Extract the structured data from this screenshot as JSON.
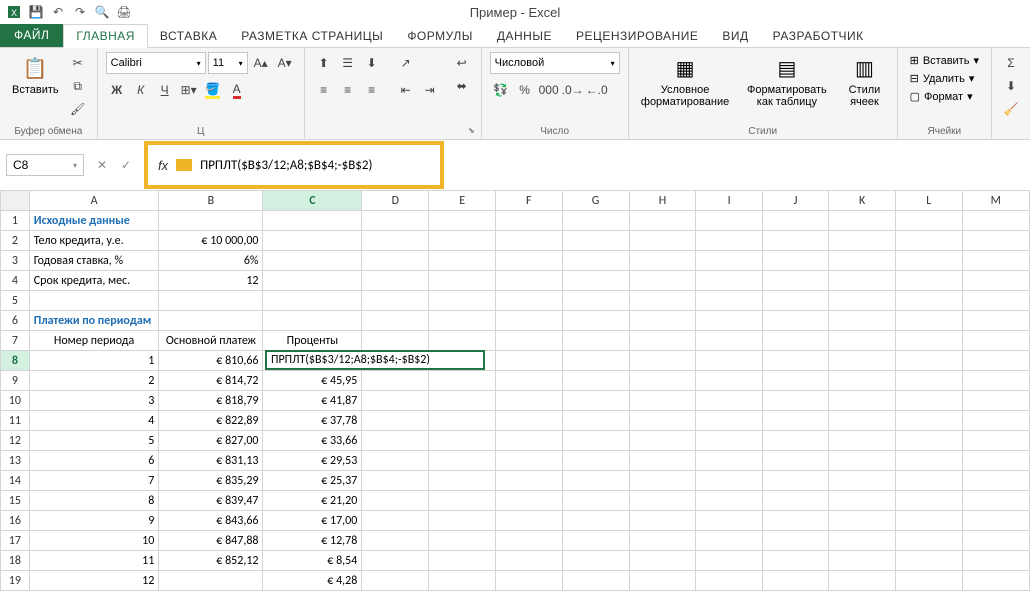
{
  "app": {
    "title": "Пример - Excel"
  },
  "qat": {
    "save": "💾",
    "undo": "↶",
    "redo": "↷",
    "preview": "🔍",
    "print": "🖨"
  },
  "tabs": {
    "file": "ФАЙЛ",
    "items": [
      "ГЛАВНАЯ",
      "ВСТАВКА",
      "РАЗМЕТКА СТРАНИЦЫ",
      "ФОРМУЛЫ",
      "ДАННЫЕ",
      "РЕЦЕНЗИРОВАНИЕ",
      "ВИД",
      "РАЗРАБОТЧИК"
    ],
    "active": 0
  },
  "ribbon": {
    "clipboard": {
      "label": "Буфер обмена",
      "paste": "Вставить"
    },
    "font": {
      "label": "Ц",
      "name": "Calibri",
      "size": "11",
      "bold": "Ж",
      "italic": "К",
      "underline": "Ч"
    },
    "number": {
      "label": "Число",
      "format": "Числовой"
    },
    "styles": {
      "label": "Стили",
      "cond": "Условное форматирование",
      "table": "Форматировать как таблицу",
      "cell": "Стили ячеек"
    },
    "cells": {
      "label": "Ячейки",
      "insert": "Вставить",
      "delete": "Удалить",
      "format": "Формат"
    }
  },
  "namebox": "C8",
  "formula_display": "ПРПЛТ($B$3/12;A8;$B$4;-$B$2)",
  "columns": [
    "A",
    "B",
    "C",
    "D",
    "E",
    "F",
    "G",
    "H",
    "I",
    "J",
    "K",
    "L",
    "M"
  ],
  "rows": [
    {
      "n": 1,
      "A": "Исходные данные",
      "cls": "section-hdr"
    },
    {
      "n": 2,
      "A": "Тело кредита, у.е.",
      "B": "€      10 000,00"
    },
    {
      "n": 3,
      "A": "Годовая ставка, %",
      "B": "6%"
    },
    {
      "n": 4,
      "A": "Срок кредита, мес.",
      "B": "12"
    },
    {
      "n": 5
    },
    {
      "n": 6,
      "A": "Платежи по периодам",
      "cls": "section-hdr"
    },
    {
      "n": 7,
      "A": "Номер периода",
      "B": "Основной платеж",
      "C": "Проценты",
      "hdr": true
    },
    {
      "n": 8,
      "A": "1",
      "B": "€            810,66",
      "C_formula": "ПРПЛТ($B$3/12;A8;$B$4;-$B$2)",
      "active": true
    },
    {
      "n": 9,
      "A": "2",
      "B": "€            814,72",
      "C": "€              45,95"
    },
    {
      "n": 10,
      "A": "3",
      "B": "€            818,79",
      "C": "€              41,87"
    },
    {
      "n": 11,
      "A": "4",
      "B": "€            822,89",
      "C": "€              37,78"
    },
    {
      "n": 12,
      "A": "5",
      "B": "€            827,00",
      "C": "€              33,66"
    },
    {
      "n": 13,
      "A": "6",
      "B": "€            831,13",
      "C": "€              29,53"
    },
    {
      "n": 14,
      "A": "7",
      "B": "€            835,29",
      "C": "€              25,37"
    },
    {
      "n": 15,
      "A": "8",
      "B": "€            839,47",
      "C": "€              21,20"
    },
    {
      "n": 16,
      "A": "9",
      "B": "€            843,66",
      "C": "€              17,00"
    },
    {
      "n": 17,
      "A": "10",
      "B": "€            847,88",
      "C": "€              12,78"
    },
    {
      "n": 18,
      "A": "11",
      "B": "€            852,12",
      "C": "€                8,54"
    },
    {
      "n": 19,
      "A": "12",
      "B": "",
      "C": "€                4,28"
    }
  ]
}
